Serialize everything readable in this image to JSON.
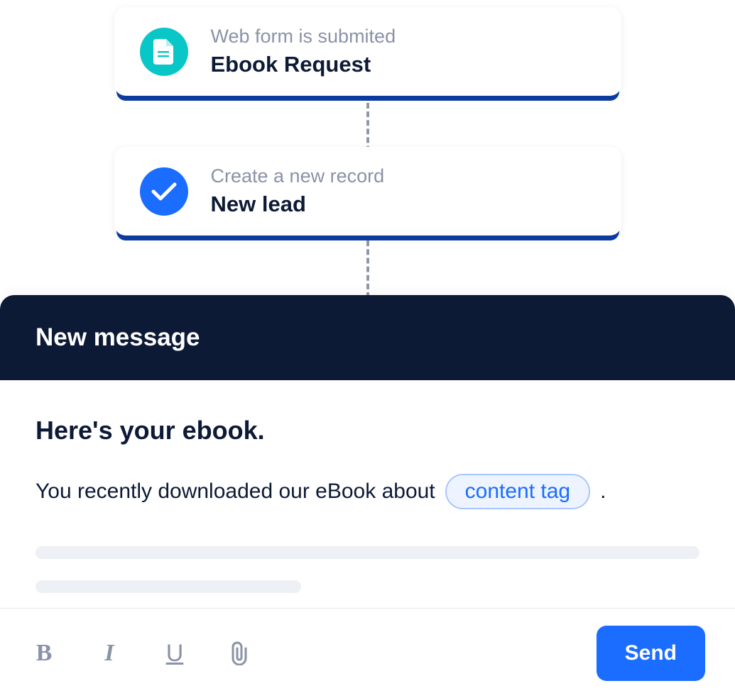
{
  "workflow": {
    "steps": [
      {
        "subtitle": "Web form is submited",
        "title": "Ebook Request",
        "icon": "document-icon",
        "icon_color": "teal"
      },
      {
        "subtitle": "Create a new record",
        "title": "New lead",
        "icon": "check-icon",
        "icon_color": "blue"
      }
    ]
  },
  "message": {
    "header": "New message",
    "subject": "Here's your ebook.",
    "body_text": "You recently downloaded our eBook about",
    "content_tag_label": "content tag",
    "body_suffix": ".",
    "send_label": "Send"
  }
}
